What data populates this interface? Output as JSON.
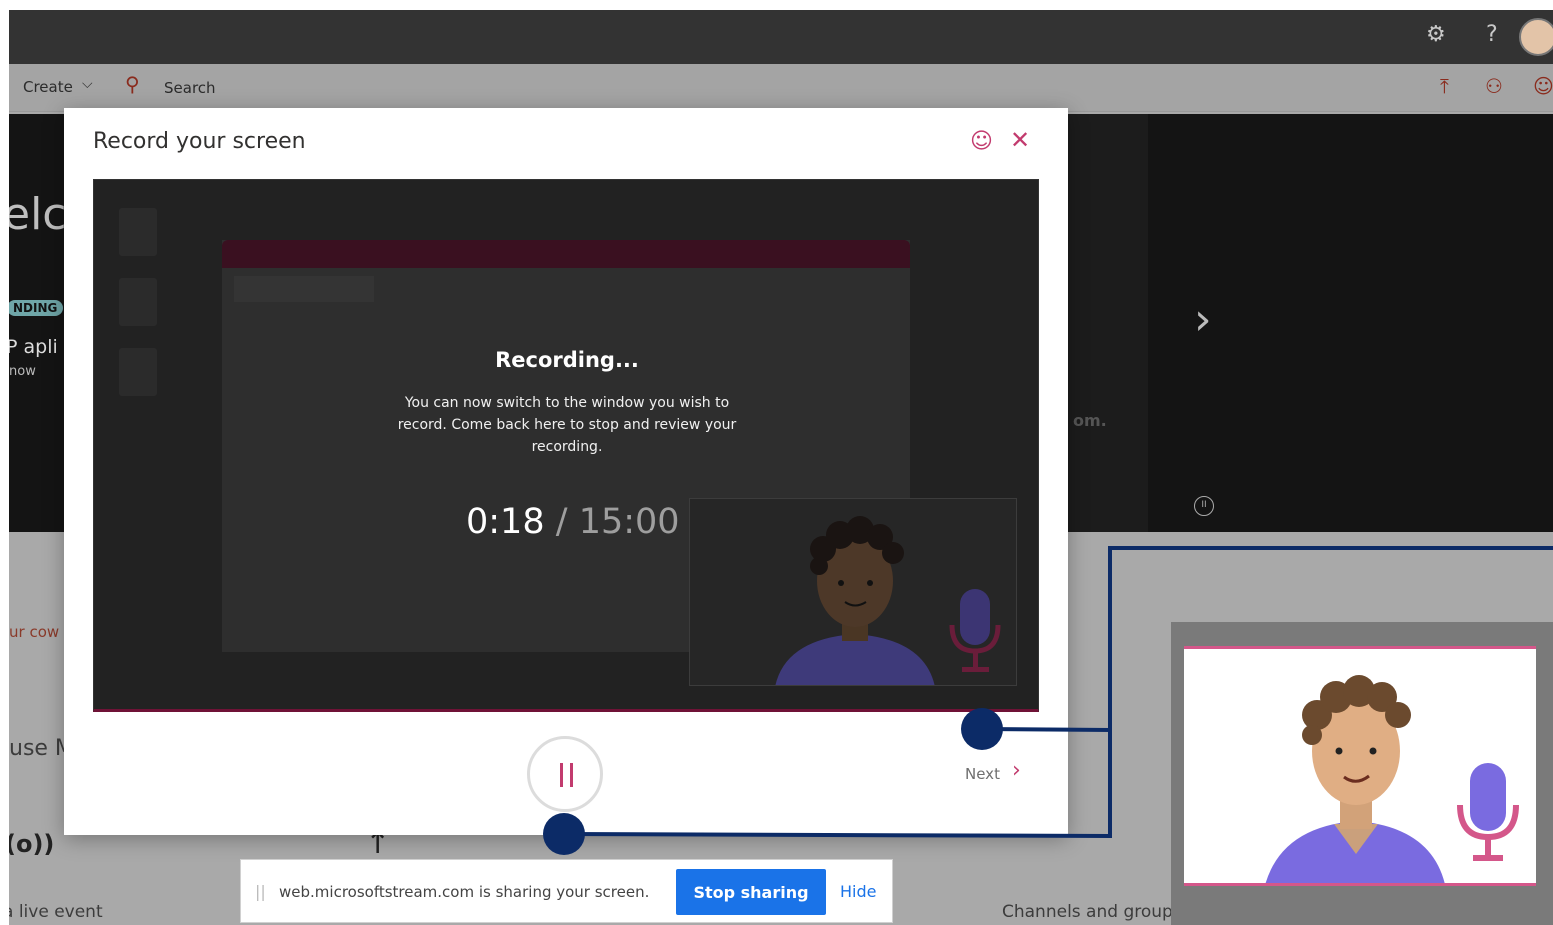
{
  "app": {
    "command_bar": {
      "create_label": "Create",
      "search_placeholder": "Search"
    },
    "hero": {
      "welcome_fragment": "elco",
      "trending_fragment": "NDING",
      "title_fragment": "P apli",
      "time_fragment": "now",
      "right_fragment": "om."
    },
    "lower": {
      "cowork_fragment": "ur cow",
      "use_fragment": "use M",
      "live_event_fragment": "a live event",
      "channels_label": "Channels and groups"
    }
  },
  "dialog": {
    "title": "Record your screen",
    "recording_title": "Recording...",
    "recording_description": "You can now switch to the window you wish to record. Come back here to stop and review your recording.",
    "timer": {
      "elapsed": "0:18",
      "separator": "/",
      "limit": "15:00"
    },
    "next_label": "Next"
  },
  "sharing_bar": {
    "message": "web.microsoftstream.com is sharing your screen.",
    "stop_label": "Stop sharing",
    "hide_label": "Hide"
  },
  "icons": {
    "settings": "gear-icon",
    "help": "help-icon",
    "search": "search-icon",
    "feedback": "smiley-icon",
    "close": "close-icon",
    "microphone": "microphone-icon"
  },
  "colors": {
    "accent": "#c23b6e",
    "stop_button": "#1a73e8",
    "callout": "#0c2b67",
    "mic": "#7a6be0"
  }
}
